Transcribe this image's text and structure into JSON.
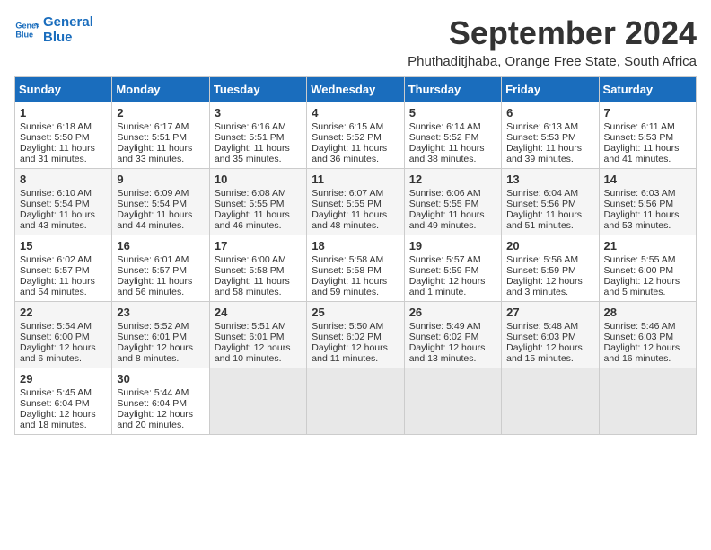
{
  "logo": {
    "line1": "General",
    "line2": "Blue"
  },
  "title": "September 2024",
  "subtitle": "Phuthaditjhaba, Orange Free State, South Africa",
  "days_of_week": [
    "Sunday",
    "Monday",
    "Tuesday",
    "Wednesday",
    "Thursday",
    "Friday",
    "Saturday"
  ],
  "weeks": [
    [
      {
        "day": "1",
        "sunrise": "6:18 AM",
        "sunset": "5:50 PM",
        "daylight": "11 hours and 31 minutes."
      },
      {
        "day": "2",
        "sunrise": "6:17 AM",
        "sunset": "5:51 PM",
        "daylight": "11 hours and 33 minutes."
      },
      {
        "day": "3",
        "sunrise": "6:16 AM",
        "sunset": "5:51 PM",
        "daylight": "11 hours and 35 minutes."
      },
      {
        "day": "4",
        "sunrise": "6:15 AM",
        "sunset": "5:52 PM",
        "daylight": "11 hours and 36 minutes."
      },
      {
        "day": "5",
        "sunrise": "6:14 AM",
        "sunset": "5:52 PM",
        "daylight": "11 hours and 38 minutes."
      },
      {
        "day": "6",
        "sunrise": "6:13 AM",
        "sunset": "5:53 PM",
        "daylight": "11 hours and 39 minutes."
      },
      {
        "day": "7",
        "sunrise": "6:11 AM",
        "sunset": "5:53 PM",
        "daylight": "11 hours and 41 minutes."
      }
    ],
    [
      {
        "day": "8",
        "sunrise": "6:10 AM",
        "sunset": "5:54 PM",
        "daylight": "11 hours and 43 minutes."
      },
      {
        "day": "9",
        "sunrise": "6:09 AM",
        "sunset": "5:54 PM",
        "daylight": "11 hours and 44 minutes."
      },
      {
        "day": "10",
        "sunrise": "6:08 AM",
        "sunset": "5:55 PM",
        "daylight": "11 hours and 46 minutes."
      },
      {
        "day": "11",
        "sunrise": "6:07 AM",
        "sunset": "5:55 PM",
        "daylight": "11 hours and 48 minutes."
      },
      {
        "day": "12",
        "sunrise": "6:06 AM",
        "sunset": "5:55 PM",
        "daylight": "11 hours and 49 minutes."
      },
      {
        "day": "13",
        "sunrise": "6:04 AM",
        "sunset": "5:56 PM",
        "daylight": "11 hours and 51 minutes."
      },
      {
        "day": "14",
        "sunrise": "6:03 AM",
        "sunset": "5:56 PM",
        "daylight": "11 hours and 53 minutes."
      }
    ],
    [
      {
        "day": "15",
        "sunrise": "6:02 AM",
        "sunset": "5:57 PM",
        "daylight": "11 hours and 54 minutes."
      },
      {
        "day": "16",
        "sunrise": "6:01 AM",
        "sunset": "5:57 PM",
        "daylight": "11 hours and 56 minutes."
      },
      {
        "day": "17",
        "sunrise": "6:00 AM",
        "sunset": "5:58 PM",
        "daylight": "11 hours and 58 minutes."
      },
      {
        "day": "18",
        "sunrise": "5:58 AM",
        "sunset": "5:58 PM",
        "daylight": "11 hours and 59 minutes."
      },
      {
        "day": "19",
        "sunrise": "5:57 AM",
        "sunset": "5:59 PM",
        "daylight": "12 hours and 1 minute."
      },
      {
        "day": "20",
        "sunrise": "5:56 AM",
        "sunset": "5:59 PM",
        "daylight": "12 hours and 3 minutes."
      },
      {
        "day": "21",
        "sunrise": "5:55 AM",
        "sunset": "6:00 PM",
        "daylight": "12 hours and 5 minutes."
      }
    ],
    [
      {
        "day": "22",
        "sunrise": "5:54 AM",
        "sunset": "6:00 PM",
        "daylight": "12 hours and 6 minutes."
      },
      {
        "day": "23",
        "sunrise": "5:52 AM",
        "sunset": "6:01 PM",
        "daylight": "12 hours and 8 minutes."
      },
      {
        "day": "24",
        "sunrise": "5:51 AM",
        "sunset": "6:01 PM",
        "daylight": "12 hours and 10 minutes."
      },
      {
        "day": "25",
        "sunrise": "5:50 AM",
        "sunset": "6:02 PM",
        "daylight": "12 hours and 11 minutes."
      },
      {
        "day": "26",
        "sunrise": "5:49 AM",
        "sunset": "6:02 PM",
        "daylight": "12 hours and 13 minutes."
      },
      {
        "day": "27",
        "sunrise": "5:48 AM",
        "sunset": "6:03 PM",
        "daylight": "12 hours and 15 minutes."
      },
      {
        "day": "28",
        "sunrise": "5:46 AM",
        "sunset": "6:03 PM",
        "daylight": "12 hours and 16 minutes."
      }
    ],
    [
      {
        "day": "29",
        "sunrise": "5:45 AM",
        "sunset": "6:04 PM",
        "daylight": "12 hours and 18 minutes."
      },
      {
        "day": "30",
        "sunrise": "5:44 AM",
        "sunset": "6:04 PM",
        "daylight": "12 hours and 20 minutes."
      },
      null,
      null,
      null,
      null,
      null
    ]
  ]
}
